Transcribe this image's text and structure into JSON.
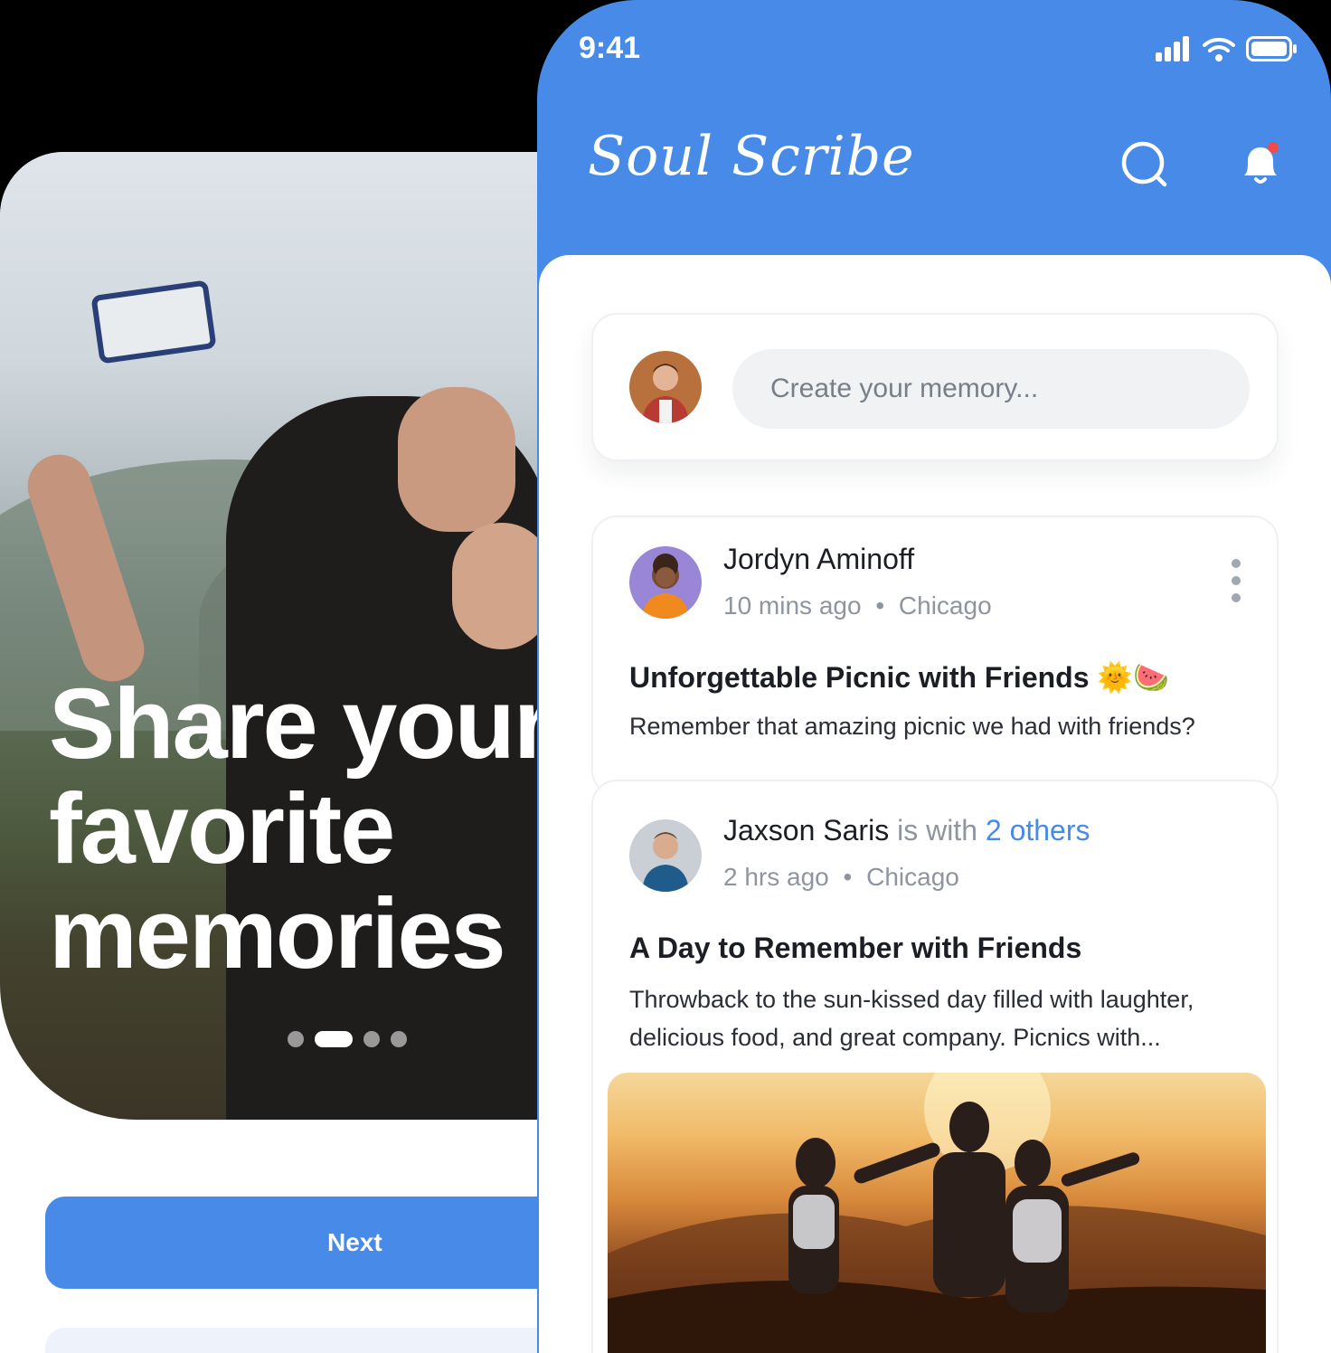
{
  "onboarding": {
    "headline": "Share your\nfavorite\nmemories",
    "pager": {
      "count": 4,
      "active_index": 1
    },
    "next_label": "Next"
  },
  "app": {
    "status": {
      "time": "9:41"
    },
    "brand": "Soul Scribe",
    "composer": {
      "placeholder": "Create your memory..."
    },
    "posts": [
      {
        "author": "Jordyn Aminoff",
        "time": "10 mins ago",
        "separator": "•",
        "location": "Chicago",
        "title": "Unforgettable Picnic with Friends 🌞🍉",
        "body": "Remember that amazing picnic we had with friends?"
      },
      {
        "author": "Jaxson Saris",
        "with_text": "is with",
        "others": "2 others",
        "time": "2 hrs ago",
        "separator": "•",
        "location": "Chicago",
        "title": "A Day to Remember with Friends",
        "body": "Throwback to the sun-kissed day filled with laughter, delicious food, and great company. Picnics with..."
      }
    ]
  },
  "colors": {
    "accent": "#478ae7",
    "notification_dot": "#f04b4b",
    "text_primary": "#1b1e24",
    "text_muted": "#8e959e"
  },
  "icons": [
    "signal-icon",
    "wifi-icon",
    "battery-icon",
    "search-icon",
    "bell-icon",
    "more-vertical-icon"
  ]
}
